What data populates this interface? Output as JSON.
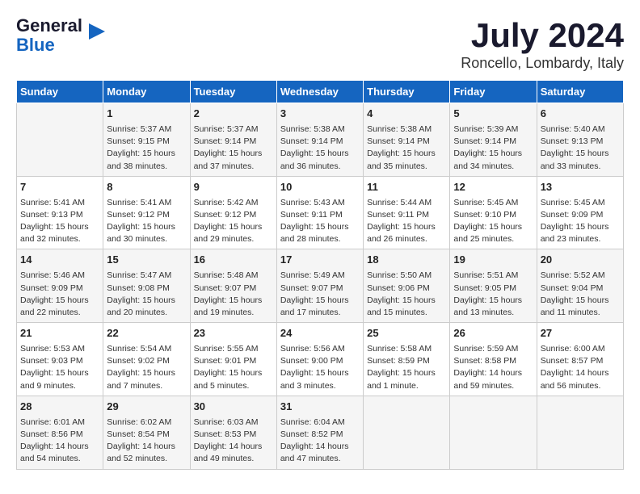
{
  "header": {
    "logo_line1": "General",
    "logo_line2": "Blue",
    "title": "July 2024",
    "subtitle": "Roncello, Lombardy, Italy"
  },
  "calendar": {
    "days_of_week": [
      "Sunday",
      "Monday",
      "Tuesday",
      "Wednesday",
      "Thursday",
      "Friday",
      "Saturday"
    ],
    "weeks": [
      [
        {
          "day": "",
          "info": ""
        },
        {
          "day": "1",
          "info": "Sunrise: 5:37 AM\nSunset: 9:15 PM\nDaylight: 15 hours\nand 38 minutes."
        },
        {
          "day": "2",
          "info": "Sunrise: 5:37 AM\nSunset: 9:14 PM\nDaylight: 15 hours\nand 37 minutes."
        },
        {
          "day": "3",
          "info": "Sunrise: 5:38 AM\nSunset: 9:14 PM\nDaylight: 15 hours\nand 36 minutes."
        },
        {
          "day": "4",
          "info": "Sunrise: 5:38 AM\nSunset: 9:14 PM\nDaylight: 15 hours\nand 35 minutes."
        },
        {
          "day": "5",
          "info": "Sunrise: 5:39 AM\nSunset: 9:14 PM\nDaylight: 15 hours\nand 34 minutes."
        },
        {
          "day": "6",
          "info": "Sunrise: 5:40 AM\nSunset: 9:13 PM\nDaylight: 15 hours\nand 33 minutes."
        }
      ],
      [
        {
          "day": "7",
          "info": "Sunrise: 5:41 AM\nSunset: 9:13 PM\nDaylight: 15 hours\nand 32 minutes."
        },
        {
          "day": "8",
          "info": "Sunrise: 5:41 AM\nSunset: 9:12 PM\nDaylight: 15 hours\nand 30 minutes."
        },
        {
          "day": "9",
          "info": "Sunrise: 5:42 AM\nSunset: 9:12 PM\nDaylight: 15 hours\nand 29 minutes."
        },
        {
          "day": "10",
          "info": "Sunrise: 5:43 AM\nSunset: 9:11 PM\nDaylight: 15 hours\nand 28 minutes."
        },
        {
          "day": "11",
          "info": "Sunrise: 5:44 AM\nSunset: 9:11 PM\nDaylight: 15 hours\nand 26 minutes."
        },
        {
          "day": "12",
          "info": "Sunrise: 5:45 AM\nSunset: 9:10 PM\nDaylight: 15 hours\nand 25 minutes."
        },
        {
          "day": "13",
          "info": "Sunrise: 5:45 AM\nSunset: 9:09 PM\nDaylight: 15 hours\nand 23 minutes."
        }
      ],
      [
        {
          "day": "14",
          "info": "Sunrise: 5:46 AM\nSunset: 9:09 PM\nDaylight: 15 hours\nand 22 minutes."
        },
        {
          "day": "15",
          "info": "Sunrise: 5:47 AM\nSunset: 9:08 PM\nDaylight: 15 hours\nand 20 minutes."
        },
        {
          "day": "16",
          "info": "Sunrise: 5:48 AM\nSunset: 9:07 PM\nDaylight: 15 hours\nand 19 minutes."
        },
        {
          "day": "17",
          "info": "Sunrise: 5:49 AM\nSunset: 9:07 PM\nDaylight: 15 hours\nand 17 minutes."
        },
        {
          "day": "18",
          "info": "Sunrise: 5:50 AM\nSunset: 9:06 PM\nDaylight: 15 hours\nand 15 minutes."
        },
        {
          "day": "19",
          "info": "Sunrise: 5:51 AM\nSunset: 9:05 PM\nDaylight: 15 hours\nand 13 minutes."
        },
        {
          "day": "20",
          "info": "Sunrise: 5:52 AM\nSunset: 9:04 PM\nDaylight: 15 hours\nand 11 minutes."
        }
      ],
      [
        {
          "day": "21",
          "info": "Sunrise: 5:53 AM\nSunset: 9:03 PM\nDaylight: 15 hours\nand 9 minutes."
        },
        {
          "day": "22",
          "info": "Sunrise: 5:54 AM\nSunset: 9:02 PM\nDaylight: 15 hours\nand 7 minutes."
        },
        {
          "day": "23",
          "info": "Sunrise: 5:55 AM\nSunset: 9:01 PM\nDaylight: 15 hours\nand 5 minutes."
        },
        {
          "day": "24",
          "info": "Sunrise: 5:56 AM\nSunset: 9:00 PM\nDaylight: 15 hours\nand 3 minutes."
        },
        {
          "day": "25",
          "info": "Sunrise: 5:58 AM\nSunset: 8:59 PM\nDaylight: 15 hours\nand 1 minute."
        },
        {
          "day": "26",
          "info": "Sunrise: 5:59 AM\nSunset: 8:58 PM\nDaylight: 14 hours\nand 59 minutes."
        },
        {
          "day": "27",
          "info": "Sunrise: 6:00 AM\nSunset: 8:57 PM\nDaylight: 14 hours\nand 56 minutes."
        }
      ],
      [
        {
          "day": "28",
          "info": "Sunrise: 6:01 AM\nSunset: 8:56 PM\nDaylight: 14 hours\nand 54 minutes."
        },
        {
          "day": "29",
          "info": "Sunrise: 6:02 AM\nSunset: 8:54 PM\nDaylight: 14 hours\nand 52 minutes."
        },
        {
          "day": "30",
          "info": "Sunrise: 6:03 AM\nSunset: 8:53 PM\nDaylight: 14 hours\nand 49 minutes."
        },
        {
          "day": "31",
          "info": "Sunrise: 6:04 AM\nSunset: 8:52 PM\nDaylight: 14 hours\nand 47 minutes."
        },
        {
          "day": "",
          "info": ""
        },
        {
          "day": "",
          "info": ""
        },
        {
          "day": "",
          "info": ""
        }
      ]
    ]
  }
}
